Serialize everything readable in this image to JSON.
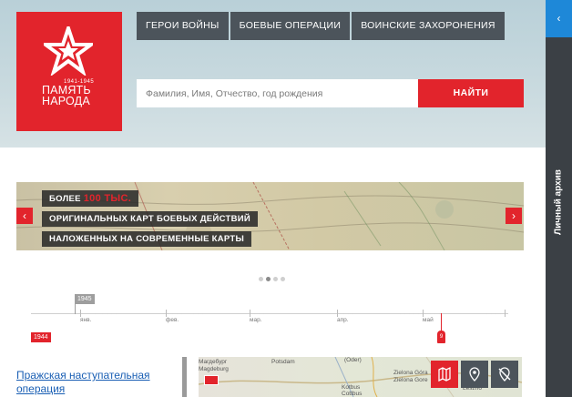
{
  "logo": {
    "years": "1941-1945",
    "name_line1": "ПАМЯТЬ",
    "name_line2": "НАРОДА"
  },
  "nav": {
    "tabs": [
      "ГЕРОИ ВОЙНЫ",
      "БОЕВЫЕ ОПЕРАЦИИ",
      "ВОИНСКИЕ ЗАХОРОНЕНИЯ"
    ]
  },
  "search": {
    "placeholder": "Фамилия, Имя, Отчество, год рождения",
    "button": "НАЙТИ"
  },
  "side": {
    "label": "Личный архив",
    "toggle_icon": "‹"
  },
  "banner": {
    "line1_prefix": "БОЛЕЕ ",
    "line1_highlight": "100 ТЫС.",
    "line2": "ОРИГИНАЛЬНЫХ КАРТ БОЕВЫХ ДЕЙСТВИЙ",
    "line3": "НАЛОЖЕННЫХ НА СОВРЕМЕННЫЕ КАРТЫ",
    "prev_icon": "‹",
    "next_icon": "›",
    "slides_count": 4,
    "active_slide": 2
  },
  "timeline": {
    "year_top": "1945",
    "year_bottom": "1944",
    "marker_label": "9",
    "months": [
      "янв.",
      "фев.",
      "мар.",
      "апр.",
      "май"
    ]
  },
  "operation": {
    "link": "Пражская наступательная операция"
  },
  "map": {
    "places": [
      "Магдебург",
      "Magdeburg",
      "Potsdam",
      "(Oder)",
      "Zielona Góra",
      "Zielona Gore",
      "Kotbus",
      "Cottbus",
      "Leszno"
    ]
  },
  "colors": {
    "accent": "#e2242c",
    "nav_bg": "#4c545b",
    "side_bg": "#3b4045",
    "link": "#1a5fb4"
  },
  "map_controls": [
    "map-fold-icon",
    "location-pin-icon",
    "no-location-icon"
  ]
}
